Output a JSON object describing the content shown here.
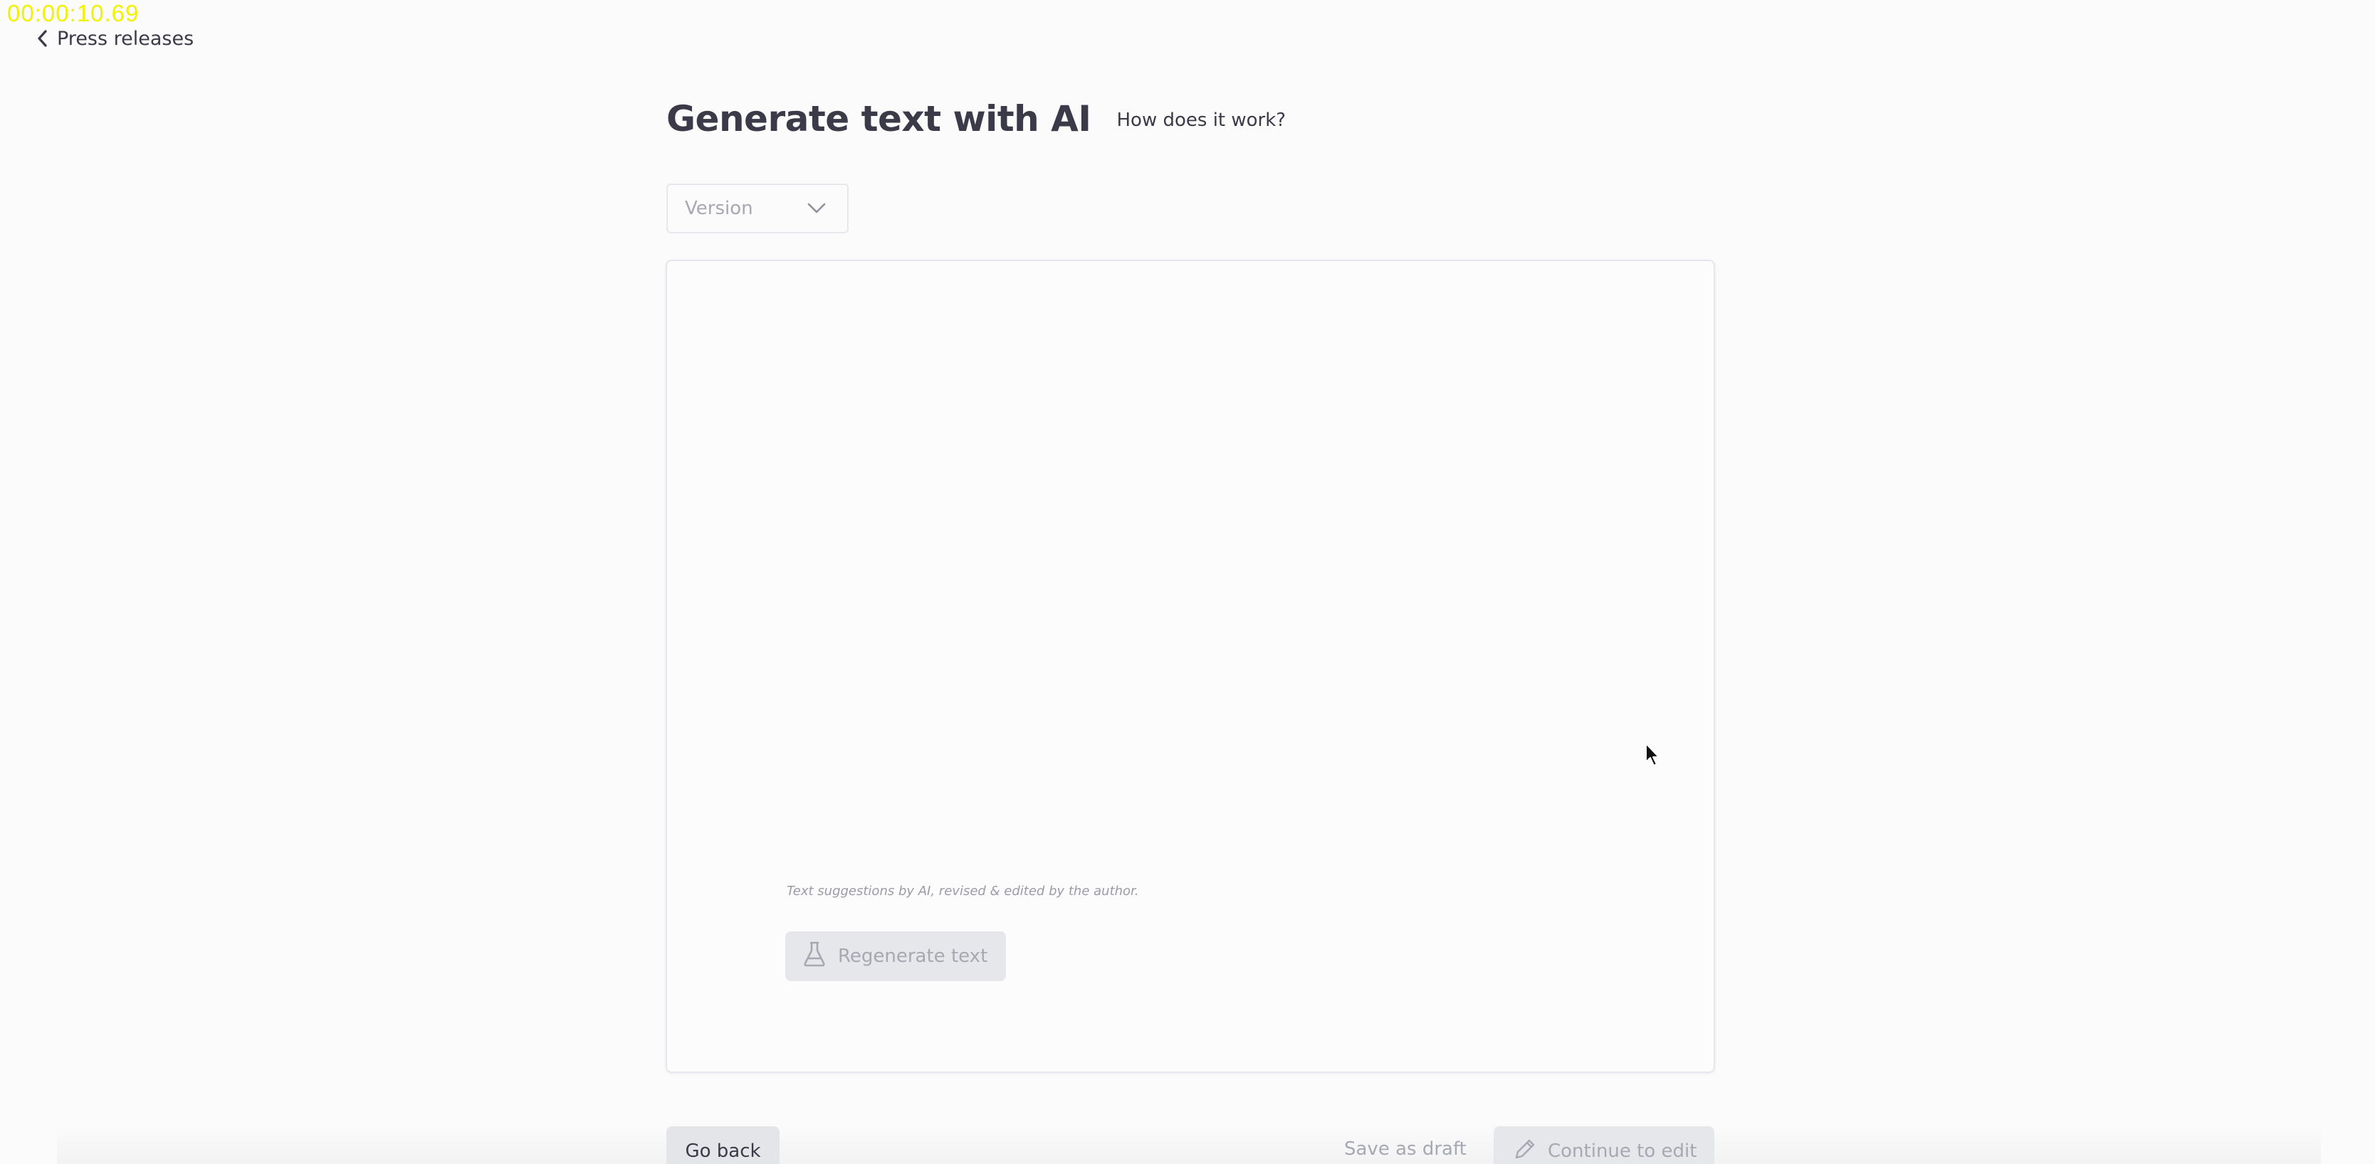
{
  "recording": {
    "timer": "00:00:10.69"
  },
  "nav": {
    "back_label": "Press releases",
    "back_icon": "chevron-left-icon"
  },
  "header": {
    "title": "Generate text with AI",
    "how_link": "How does it work?"
  },
  "version_select": {
    "placeholder": "Version",
    "icon": "chevron-down-icon"
  },
  "editor": {
    "content": "",
    "disclaimer": "Text suggestions by AI, revised & edited by the author.",
    "regenerate_label": "Regenerate text",
    "regenerate_icon": "flask-icon"
  },
  "footer": {
    "go_back_label": "Go back",
    "save_draft_label": "Save as draft",
    "continue_label": "Continue to edit",
    "continue_icon": "pencil-icon"
  },
  "colors": {
    "background": "#fbfbfc",
    "text": "#3a3a48",
    "muted": "#a6a8b2",
    "disabled_button": "#e6e7eb",
    "timer": "#f2f200"
  }
}
